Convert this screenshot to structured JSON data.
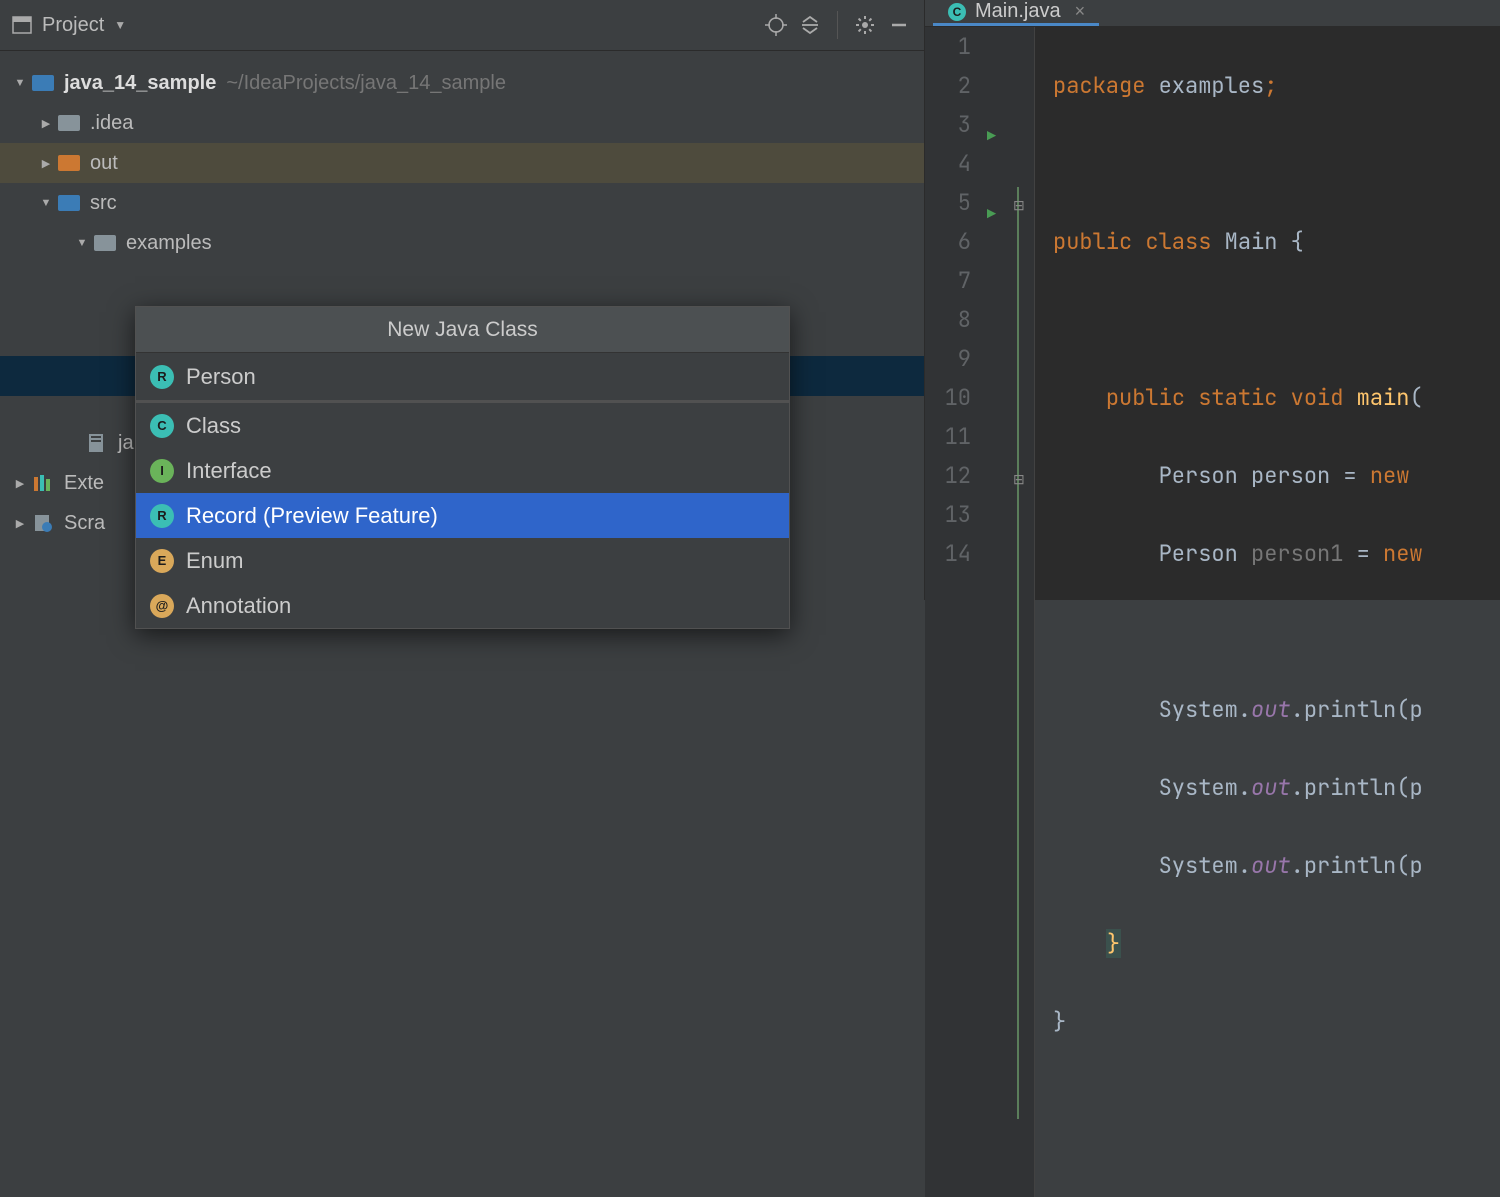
{
  "toolbar": {
    "project_label": "Project"
  },
  "tree": {
    "root": {
      "name": "java_14_sample",
      "path": "~/IdeaProjects/java_14_sample"
    },
    "idea": ".idea",
    "out": "out",
    "src": "src",
    "examples": "examples",
    "java_truncated": "ja",
    "external": "Exte",
    "scratches": "Scra"
  },
  "popup": {
    "title": "New Java Class",
    "input": "Person",
    "options": [
      {
        "badge": "C",
        "cls": "c",
        "label": "Class"
      },
      {
        "badge": "I",
        "cls": "i",
        "label": "Interface"
      },
      {
        "badge": "R",
        "cls": "r",
        "label": "Record (Preview Feature)",
        "selected": true
      },
      {
        "badge": "E",
        "cls": "e",
        "label": "Enum"
      },
      {
        "badge": "@",
        "cls": "at",
        "label": "Annotation"
      }
    ]
  },
  "editor": {
    "tab": {
      "name": "Main.java"
    },
    "lines": [
      1,
      2,
      3,
      4,
      5,
      6,
      7,
      8,
      9,
      10,
      11,
      12,
      13,
      14
    ],
    "run_markers": [
      3,
      5
    ],
    "code": {
      "l1_pkg": "package",
      "l1_name": "examples",
      "l3_public": "public",
      "l3_class": "class",
      "l3_name": "Main",
      "l5_public": "public",
      "l5_static": "static",
      "l5_void": "void",
      "l5_main": "main",
      "l6_type": "Person",
      "l6_var": "person",
      "l6_eq": "=",
      "l6_new": "new",
      "l7_type": "Person",
      "l7_var": "person1",
      "l7_eq": "=",
      "l7_new": "new",
      "l9_sys": "System",
      "l9_out": "out",
      "l9_println": "println",
      "l9_arg": "p",
      "l10_sys": "System",
      "l10_out": "out",
      "l10_println": "println",
      "l10_arg": "p",
      "l11_sys": "System",
      "l11_out": "out",
      "l11_println": "println",
      "l11_arg": "p",
      "l12_brace": "}",
      "l13_brace": "}"
    }
  }
}
